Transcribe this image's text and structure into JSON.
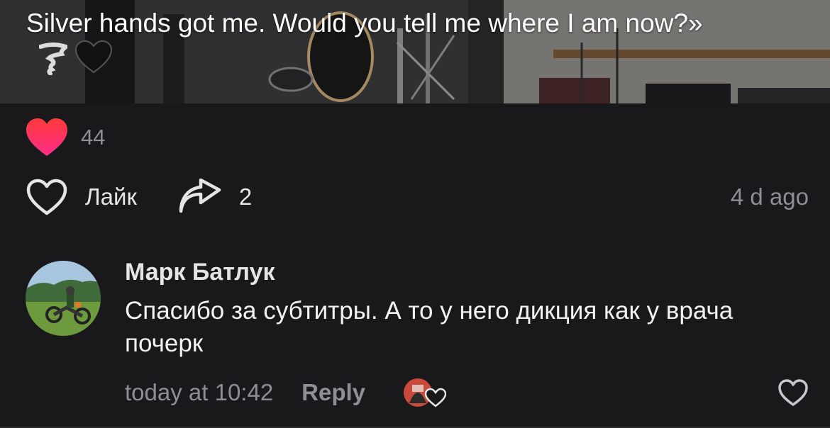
{
  "post": {
    "caption": "Silver hands got me. Would you tell me where I am now?»",
    "emoji_names": [
      "tornado-emoji",
      "black-heart-emoji"
    ]
  },
  "reactions": {
    "icon": "red-heart-icon",
    "count": "44"
  },
  "actions": {
    "like_label": "Лайк",
    "share_count": "2",
    "time_ago": "4 d ago"
  },
  "comment": {
    "author": "Марк Батлук",
    "text": "Спасибо за субтитры. А то у него дикция как у врача почерк",
    "timestamp": "today at 10:42",
    "reply_label": "Reply",
    "avatar_alt": "motorcycle-rider-avatar"
  },
  "colors": {
    "background": "#19191b",
    "muted_text": "#8e8e93",
    "heart_red": "#ff2d55"
  }
}
